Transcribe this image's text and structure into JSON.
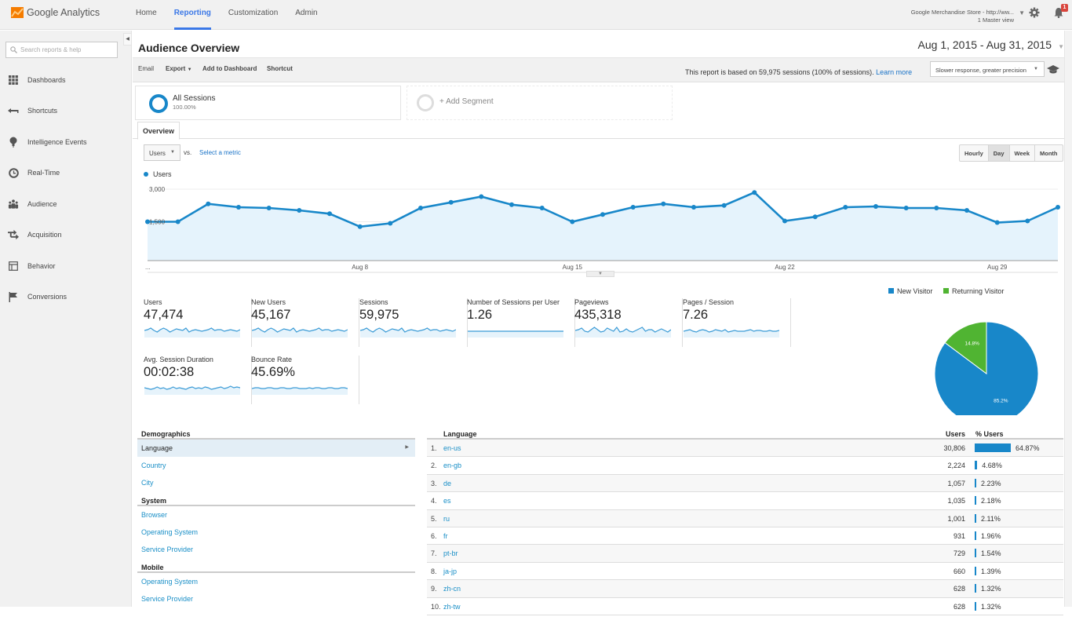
{
  "app": {
    "logo_text": "Google Analytics",
    "nav": [
      "Home",
      "Reporting",
      "Customization",
      "Admin"
    ],
    "active_nav": "Reporting",
    "account_name": "Google Merchandise Store - http://ww...",
    "account_view": "1 Master view",
    "notification_count": "1"
  },
  "sidebar": {
    "search_placeholder": "Search reports & help",
    "items": [
      {
        "label": "Dashboards",
        "icon": "grid-icon"
      },
      {
        "label": "Shortcuts",
        "icon": "shortcut-arrow-icon"
      },
      {
        "label": "Intelligence Events",
        "icon": "lightbulb-icon"
      },
      {
        "label": "Real-Time",
        "icon": "clock-icon"
      },
      {
        "label": "Audience",
        "icon": "people-icon"
      },
      {
        "label": "Acquisition",
        "icon": "arrows-icon"
      },
      {
        "label": "Behavior",
        "icon": "layout-icon"
      },
      {
        "label": "Conversions",
        "icon": "flag-icon"
      }
    ]
  },
  "header": {
    "title": "Audience Overview",
    "date_range": "Aug 1, 2015 - Aug 31, 2015"
  },
  "toolbar": {
    "email": "Email",
    "export": "Export",
    "add_to_dashboard": "Add to Dashboard",
    "shortcut": "Shortcut",
    "report_note": "This report is based on 59,975 sessions (100% of sessions).",
    "learn_more": "Learn more",
    "precision": "Slower response, greater precision"
  },
  "segments": {
    "all_name": "All Sessions",
    "all_pct": "100.00%",
    "add_label": "+ Add Segment"
  },
  "tabs": {
    "overview": "Overview"
  },
  "chart_controls": {
    "metric": "Users",
    "vs": "vs.",
    "select_metric": "Select a metric",
    "granularity": [
      "Hourly",
      "Day",
      "Week",
      "Month"
    ],
    "active_granularity": "Day"
  },
  "scorecards": [
    {
      "label": "Users",
      "value": "47,474"
    },
    {
      "label": "New Users",
      "value": "45,167"
    },
    {
      "label": "Sessions",
      "value": "59,975"
    },
    {
      "label": "Number of Sessions per User",
      "value": "1.26"
    },
    {
      "label": "Pageviews",
      "value": "435,318"
    },
    {
      "label": "Pages / Session",
      "value": "7.26"
    },
    {
      "label": "Avg. Session Duration",
      "value": "00:02:38"
    },
    {
      "label": "Bounce Rate",
      "value": "45.69%"
    }
  ],
  "chart_data": [
    {
      "type": "area",
      "title": "",
      "legend": [
        "Users"
      ],
      "legend_position": "top-left",
      "xlabel": "",
      "ylabel": "",
      "ylim": [
        0,
        3000
      ],
      "y_ticks": [
        "1,500",
        "3,000"
      ],
      "x_tick_labels": [
        "...",
        "Aug 8",
        "Aug 15",
        "Aug 22",
        "Aug 29"
      ],
      "x": [
        "Aug 1",
        "Aug 2",
        "Aug 3",
        "Aug 4",
        "Aug 5",
        "Aug 6",
        "Aug 7",
        "Aug 8",
        "Aug 9",
        "Aug 10",
        "Aug 11",
        "Aug 12",
        "Aug 13",
        "Aug 14",
        "Aug 15",
        "Aug 16",
        "Aug 17",
        "Aug 18",
        "Aug 19",
        "Aug 20",
        "Aug 21",
        "Aug 22",
        "Aug 23",
        "Aug 24",
        "Aug 25",
        "Aug 26",
        "Aug 27",
        "Aug 28",
        "Aug 29",
        "Aug 30",
        "Aug 31"
      ],
      "series": [
        {
          "name": "Users",
          "color": "#1887c9",
          "values": [
            1500,
            1500,
            2190,
            2060,
            2030,
            1940,
            1810,
            1310,
            1440,
            2030,
            2250,
            2470,
            2160,
            2030,
            1500,
            1780,
            2060,
            2190,
            2060,
            2130,
            2630,
            1530,
            1690,
            2060,
            2090,
            2030,
            2030,
            1940,
            1470,
            1530,
            2060
          ]
        }
      ],
      "grid": true
    },
    {
      "type": "pie",
      "legend": [
        "New Visitor",
        "Returning Visitor"
      ],
      "legend_position": "top",
      "slices": [
        {
          "label": "New Visitor",
          "value": 85.2,
          "color": "#1887c9",
          "display": "85.2%"
        },
        {
          "label": "Returning Visitor",
          "value": 14.8,
          "color": "#50b432",
          "display": "14.8%"
        }
      ]
    }
  ],
  "demographics": {
    "sections": [
      {
        "title": "Demographics",
        "items": [
          "Language",
          "Country",
          "City"
        ]
      },
      {
        "title": "System",
        "items": [
          "Browser",
          "Operating System",
          "Service Provider"
        ]
      },
      {
        "title": "Mobile",
        "items": [
          "Operating System",
          "Service Provider"
        ]
      }
    ],
    "active": "Language"
  },
  "language_table": {
    "headers": {
      "language": "Language",
      "users": "Users",
      "pct_users": "% Users"
    },
    "rows": [
      {
        "idx": "1.",
        "lang": "en-us",
        "users": "30,806",
        "pct": 64.87,
        "pct_label": "64.87%"
      },
      {
        "idx": "2.",
        "lang": "en-gb",
        "users": "2,224",
        "pct": 4.68,
        "pct_label": "4.68%"
      },
      {
        "idx": "3.",
        "lang": "de",
        "users": "1,057",
        "pct": 2.23,
        "pct_label": "2.23%"
      },
      {
        "idx": "4.",
        "lang": "es",
        "users": "1,035",
        "pct": 2.18,
        "pct_label": "2.18%"
      },
      {
        "idx": "5.",
        "lang": "ru",
        "users": "1,001",
        "pct": 2.11,
        "pct_label": "2.11%"
      },
      {
        "idx": "6.",
        "lang": "fr",
        "users": "931",
        "pct": 1.96,
        "pct_label": "1.96%"
      },
      {
        "idx": "7.",
        "lang": "pt-br",
        "users": "729",
        "pct": 1.54,
        "pct_label": "1.54%"
      },
      {
        "idx": "8.",
        "lang": "ja-jp",
        "users": "660",
        "pct": 1.39,
        "pct_label": "1.39%"
      },
      {
        "idx": "9.",
        "lang": "zh-cn",
        "users": "628",
        "pct": 1.32,
        "pct_label": "1.32%"
      },
      {
        "idx": "10.",
        "lang": "zh-tw",
        "users": "628",
        "pct": 1.32,
        "pct_label": "1.32%"
      }
    ]
  }
}
